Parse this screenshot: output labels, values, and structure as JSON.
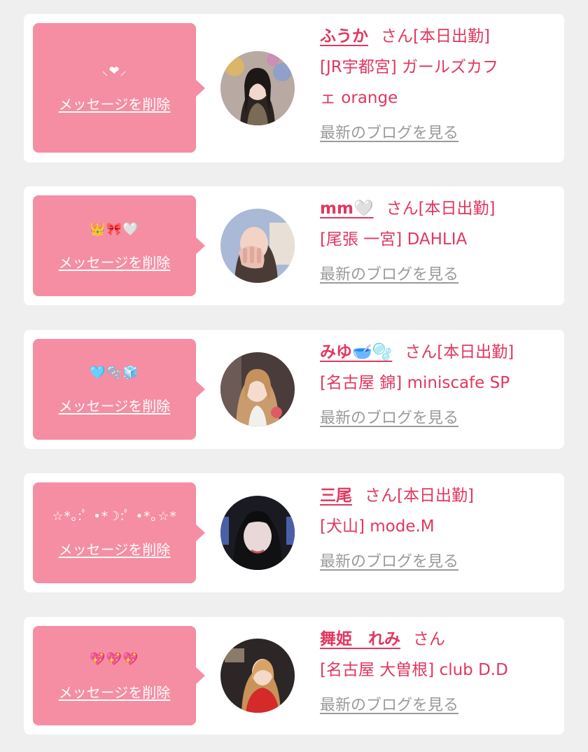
{
  "common": {
    "delete_label": "メッセージを削除",
    "blog_label": "最新のブログを見る",
    "san_suffix": "さん",
    "accent_color": "#e1375f",
    "bubble_color": "#f58ea2",
    "link_color": "#9a9a9a"
  },
  "cards": [
    {
      "message": "⸜❤︎⸝",
      "name": "ふうか",
      "name_emoji": "",
      "status": "[本日出勤]",
      "shop_line1": "[JR宇都宮] ガールズカフ",
      "shop_line2": "ェ orange"
    },
    {
      "message": "👑🎀🤍",
      "name": "mm",
      "name_emoji": "🤍",
      "status": "[本日出勤]",
      "shop_line1": "[尾張 一宮] DAHLIA",
      "shop_line2": ""
    },
    {
      "message": "🩵🫧🧊",
      "name": "みゆ",
      "name_emoji": "🥣🫧",
      "status": "[本日出勤]",
      "shop_line1": "[名古屋 錦] miniscafe SP",
      "shop_line2": ""
    },
    {
      "message": "☆*｡:ﾟ •*☽:ﾟ •*｡☆*",
      "name": "三尾",
      "name_emoji": "",
      "status": "[本日出勤]",
      "shop_line1": "[犬山] mode.M",
      "shop_line2": ""
    },
    {
      "message": "💖💖💖",
      "name": "舞姫　れみ",
      "name_emoji": "",
      "status": "",
      "shop_line1": "[名古屋 大曽根] club D.D",
      "shop_line2": ""
    }
  ]
}
